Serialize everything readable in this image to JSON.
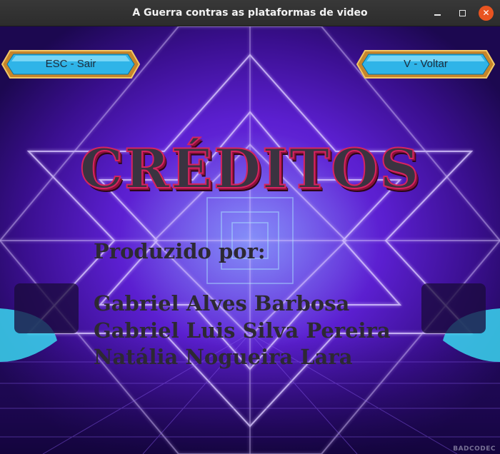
{
  "window": {
    "title": "A Guerra contras as plataformas de video"
  },
  "buttons": {
    "exit_label": "ESC - Sair",
    "back_label": "V - Voltar"
  },
  "credits": {
    "heading": "CRÉDITOS",
    "produced_by": "Produzido por:",
    "names": [
      "Gabriel Alves Barbosa",
      "Gabriel Luis Silva Pereira",
      "Natália Nogueira Lara"
    ]
  },
  "watermark": "BADCODEC",
  "colors": {
    "heading_fill": "#3a3340",
    "heading_outline": "#d6245f",
    "button_face": "#2fb4e8",
    "button_frame": "#e0a030",
    "background": "#5b1fd0"
  }
}
